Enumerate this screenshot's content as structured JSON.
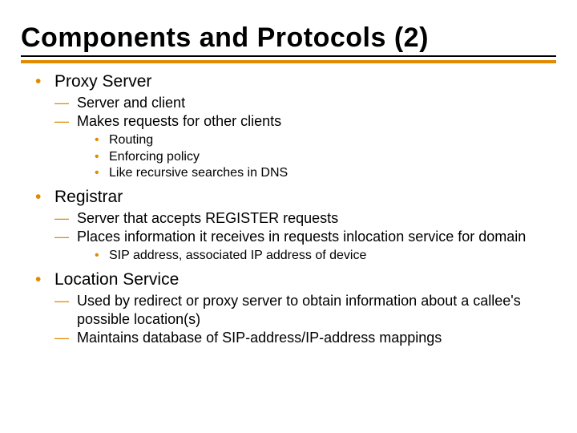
{
  "title": "Components and Protocols (2)",
  "sections": [
    {
      "heading": "Proxy Server",
      "subs": [
        {
          "text": "Server and client"
        },
        {
          "text": "Makes requests for other clients",
          "subs": [
            "Routing",
            "Enforcing policy",
            "Like recursive searches in DNS"
          ]
        }
      ]
    },
    {
      "heading": "Registrar",
      "subs": [
        {
          "text": "Server that accepts REGISTER requests"
        },
        {
          "text": "Places information it receives in requests inlocation service for domain",
          "subs": [
            "SIP address, associated IP address of device"
          ]
        }
      ]
    },
    {
      "heading": "Location Service",
      "subs": [
        {
          "text": "Used by redirect or proxy server to obtain information about a callee's possible location(s)"
        },
        {
          "text": "Maintains database of SIP-address/IP-address mappings"
        }
      ]
    }
  ]
}
